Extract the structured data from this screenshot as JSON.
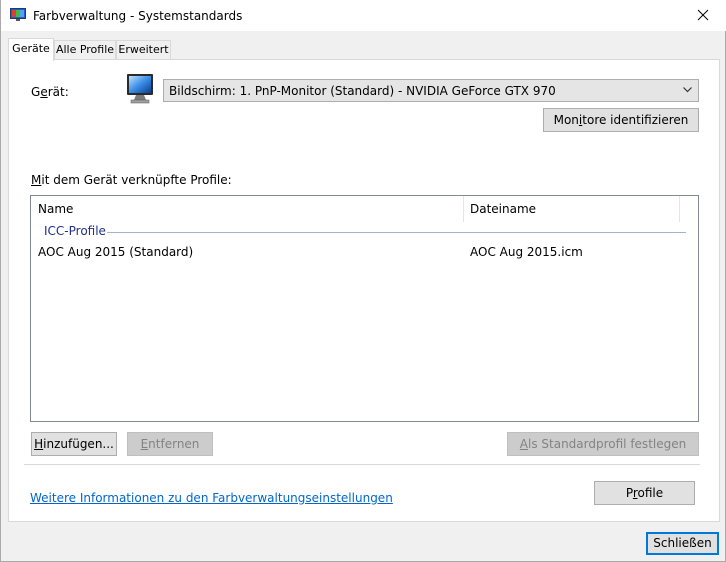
{
  "window": {
    "title": "Farbverwaltung - Systemstandards",
    "close_icon": "close-icon"
  },
  "tabs": [
    {
      "label": "Geräte",
      "active": true
    },
    {
      "label": "Alle Profile",
      "active": false
    },
    {
      "label": "Erweitert",
      "active": false
    }
  ],
  "device": {
    "label_prefix": "G",
    "label_accel": "e",
    "label_suffix": "rät:",
    "icon": "monitor-icon",
    "selected": "Bildschirm: 1. PnP-Monitor (Standard) - NVIDIA GeForce GTX 970",
    "identify_prefix": "Mon",
    "identify_accel": "i",
    "identify_suffix": "tore identifizieren"
  },
  "profiles": {
    "label_prefix": "",
    "label_accel": "M",
    "label_suffix": "it dem Gerät verknüpfte Profile:",
    "columns": [
      "Name",
      "Dateiname"
    ],
    "group": "ICC-Profile",
    "rows": [
      {
        "name": "AOC Aug 2015 (Standard)",
        "file": "AOC Aug 2015.icm"
      }
    ]
  },
  "buttons": {
    "add_accel": "H",
    "add_suffix": "inzufügen...",
    "remove_accel": "E",
    "remove_suffix": "ntfernen",
    "set_default_accel": "A",
    "set_default_suffix": "ls Standardprofil festlegen",
    "profile_prefix": "P",
    "profile_accel": "r",
    "profile_suffix": "ofile",
    "close_label": "Schließen"
  },
  "link": {
    "text": "Weitere Informationen zu den Farbverwaltungseinstellungen"
  }
}
